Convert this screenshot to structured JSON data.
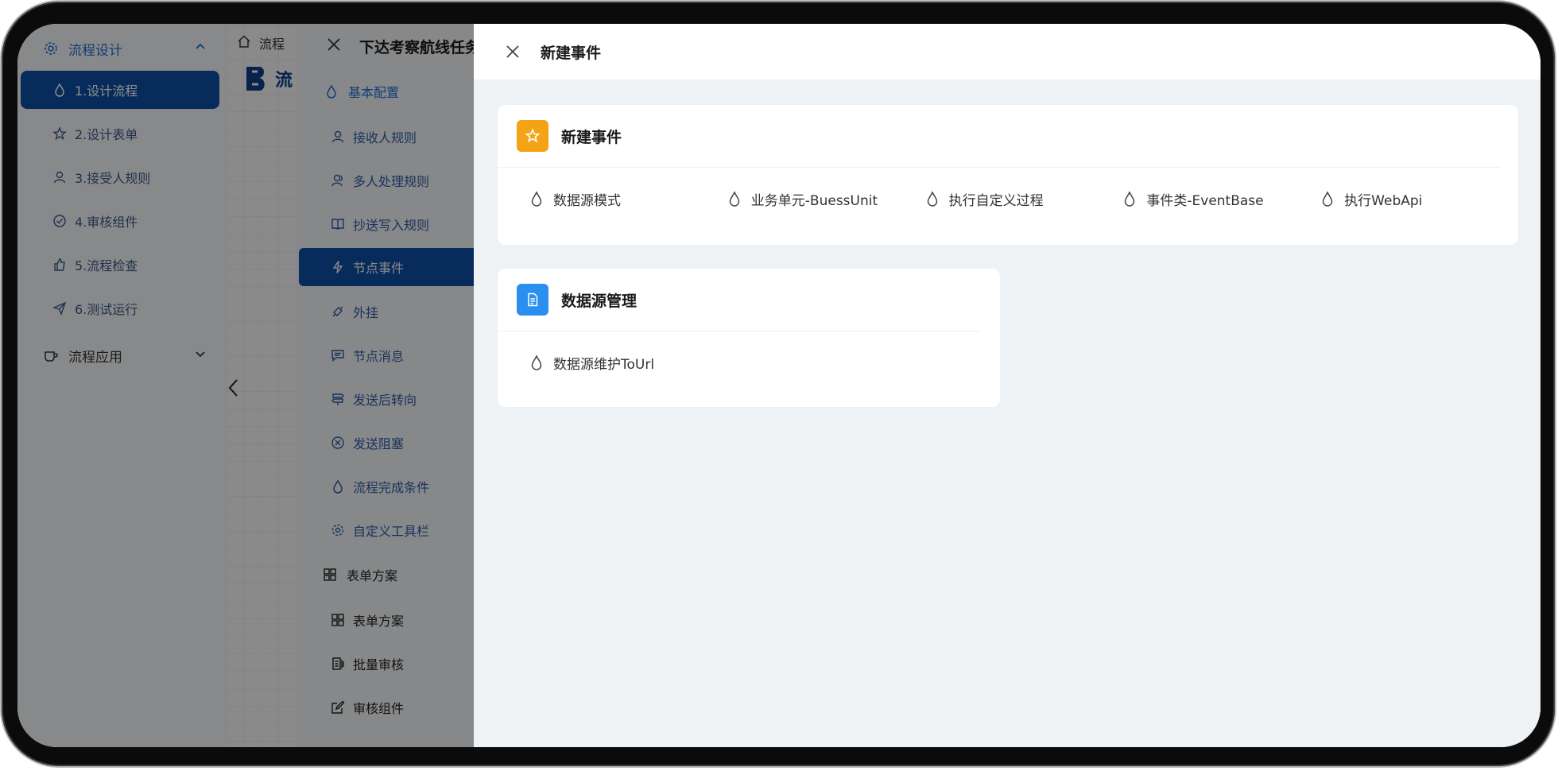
{
  "sidebar": {
    "group1": "流程设计",
    "items": [
      {
        "label": "1.设计流程",
        "icon": "drop-icon",
        "active": true
      },
      {
        "label": "2.设计表单",
        "icon": "star-icon"
      },
      {
        "label": "3.接受人规则",
        "icon": "user-icon"
      },
      {
        "label": "4.审核组件",
        "icon": "check-circle-icon"
      },
      {
        "label": "5.流程检查",
        "icon": "thumb-icon"
      },
      {
        "label": "6.测试运行",
        "icon": "send-icon"
      }
    ],
    "group2": "流程应用"
  },
  "breadcrumb": {
    "text": "流程"
  },
  "logo": {
    "text": "流"
  },
  "drawer1": {
    "title": "下达考察航线任务",
    "group1": "基本配置",
    "items": [
      {
        "label": "接收人规则",
        "icon": "user-icon"
      },
      {
        "label": "多人处理规则",
        "icon": "users-icon"
      },
      {
        "label": "抄送写入规则",
        "icon": "book-icon"
      },
      {
        "label": "节点事件",
        "icon": "bolt-icon",
        "active": true
      },
      {
        "label": "外挂",
        "icon": "plugin-icon"
      },
      {
        "label": "节点消息",
        "icon": "message-icon"
      },
      {
        "label": "发送后转向",
        "icon": "signpost-icon"
      },
      {
        "label": "发送阻塞",
        "icon": "close-circle-icon"
      },
      {
        "label": "流程完成条件",
        "icon": "drop-icon"
      },
      {
        "label": "自定义工具栏",
        "icon": "gear-icon"
      }
    ],
    "group2": "表单方案",
    "items2": [
      {
        "label": "表单方案",
        "icon": "grid-icon"
      },
      {
        "label": "批量审核",
        "icon": "batch-icon"
      },
      {
        "label": "审核组件",
        "icon": "edit-icon"
      }
    ]
  },
  "drawer2": {
    "title": "新建事件",
    "cards": [
      {
        "title": "新建事件",
        "badge_color": "#f5a316",
        "badge_icon": "star-icon",
        "items": [
          "数据源模式",
          "业务单元-BuessUnit",
          "执行自定义过程",
          "事件类-EventBase",
          "执行WebApi"
        ]
      },
      {
        "title": "数据源管理",
        "badge_color": "#2b8ff0",
        "badge_icon": "document-icon",
        "items": [
          "数据源维护ToUrl"
        ]
      }
    ]
  }
}
